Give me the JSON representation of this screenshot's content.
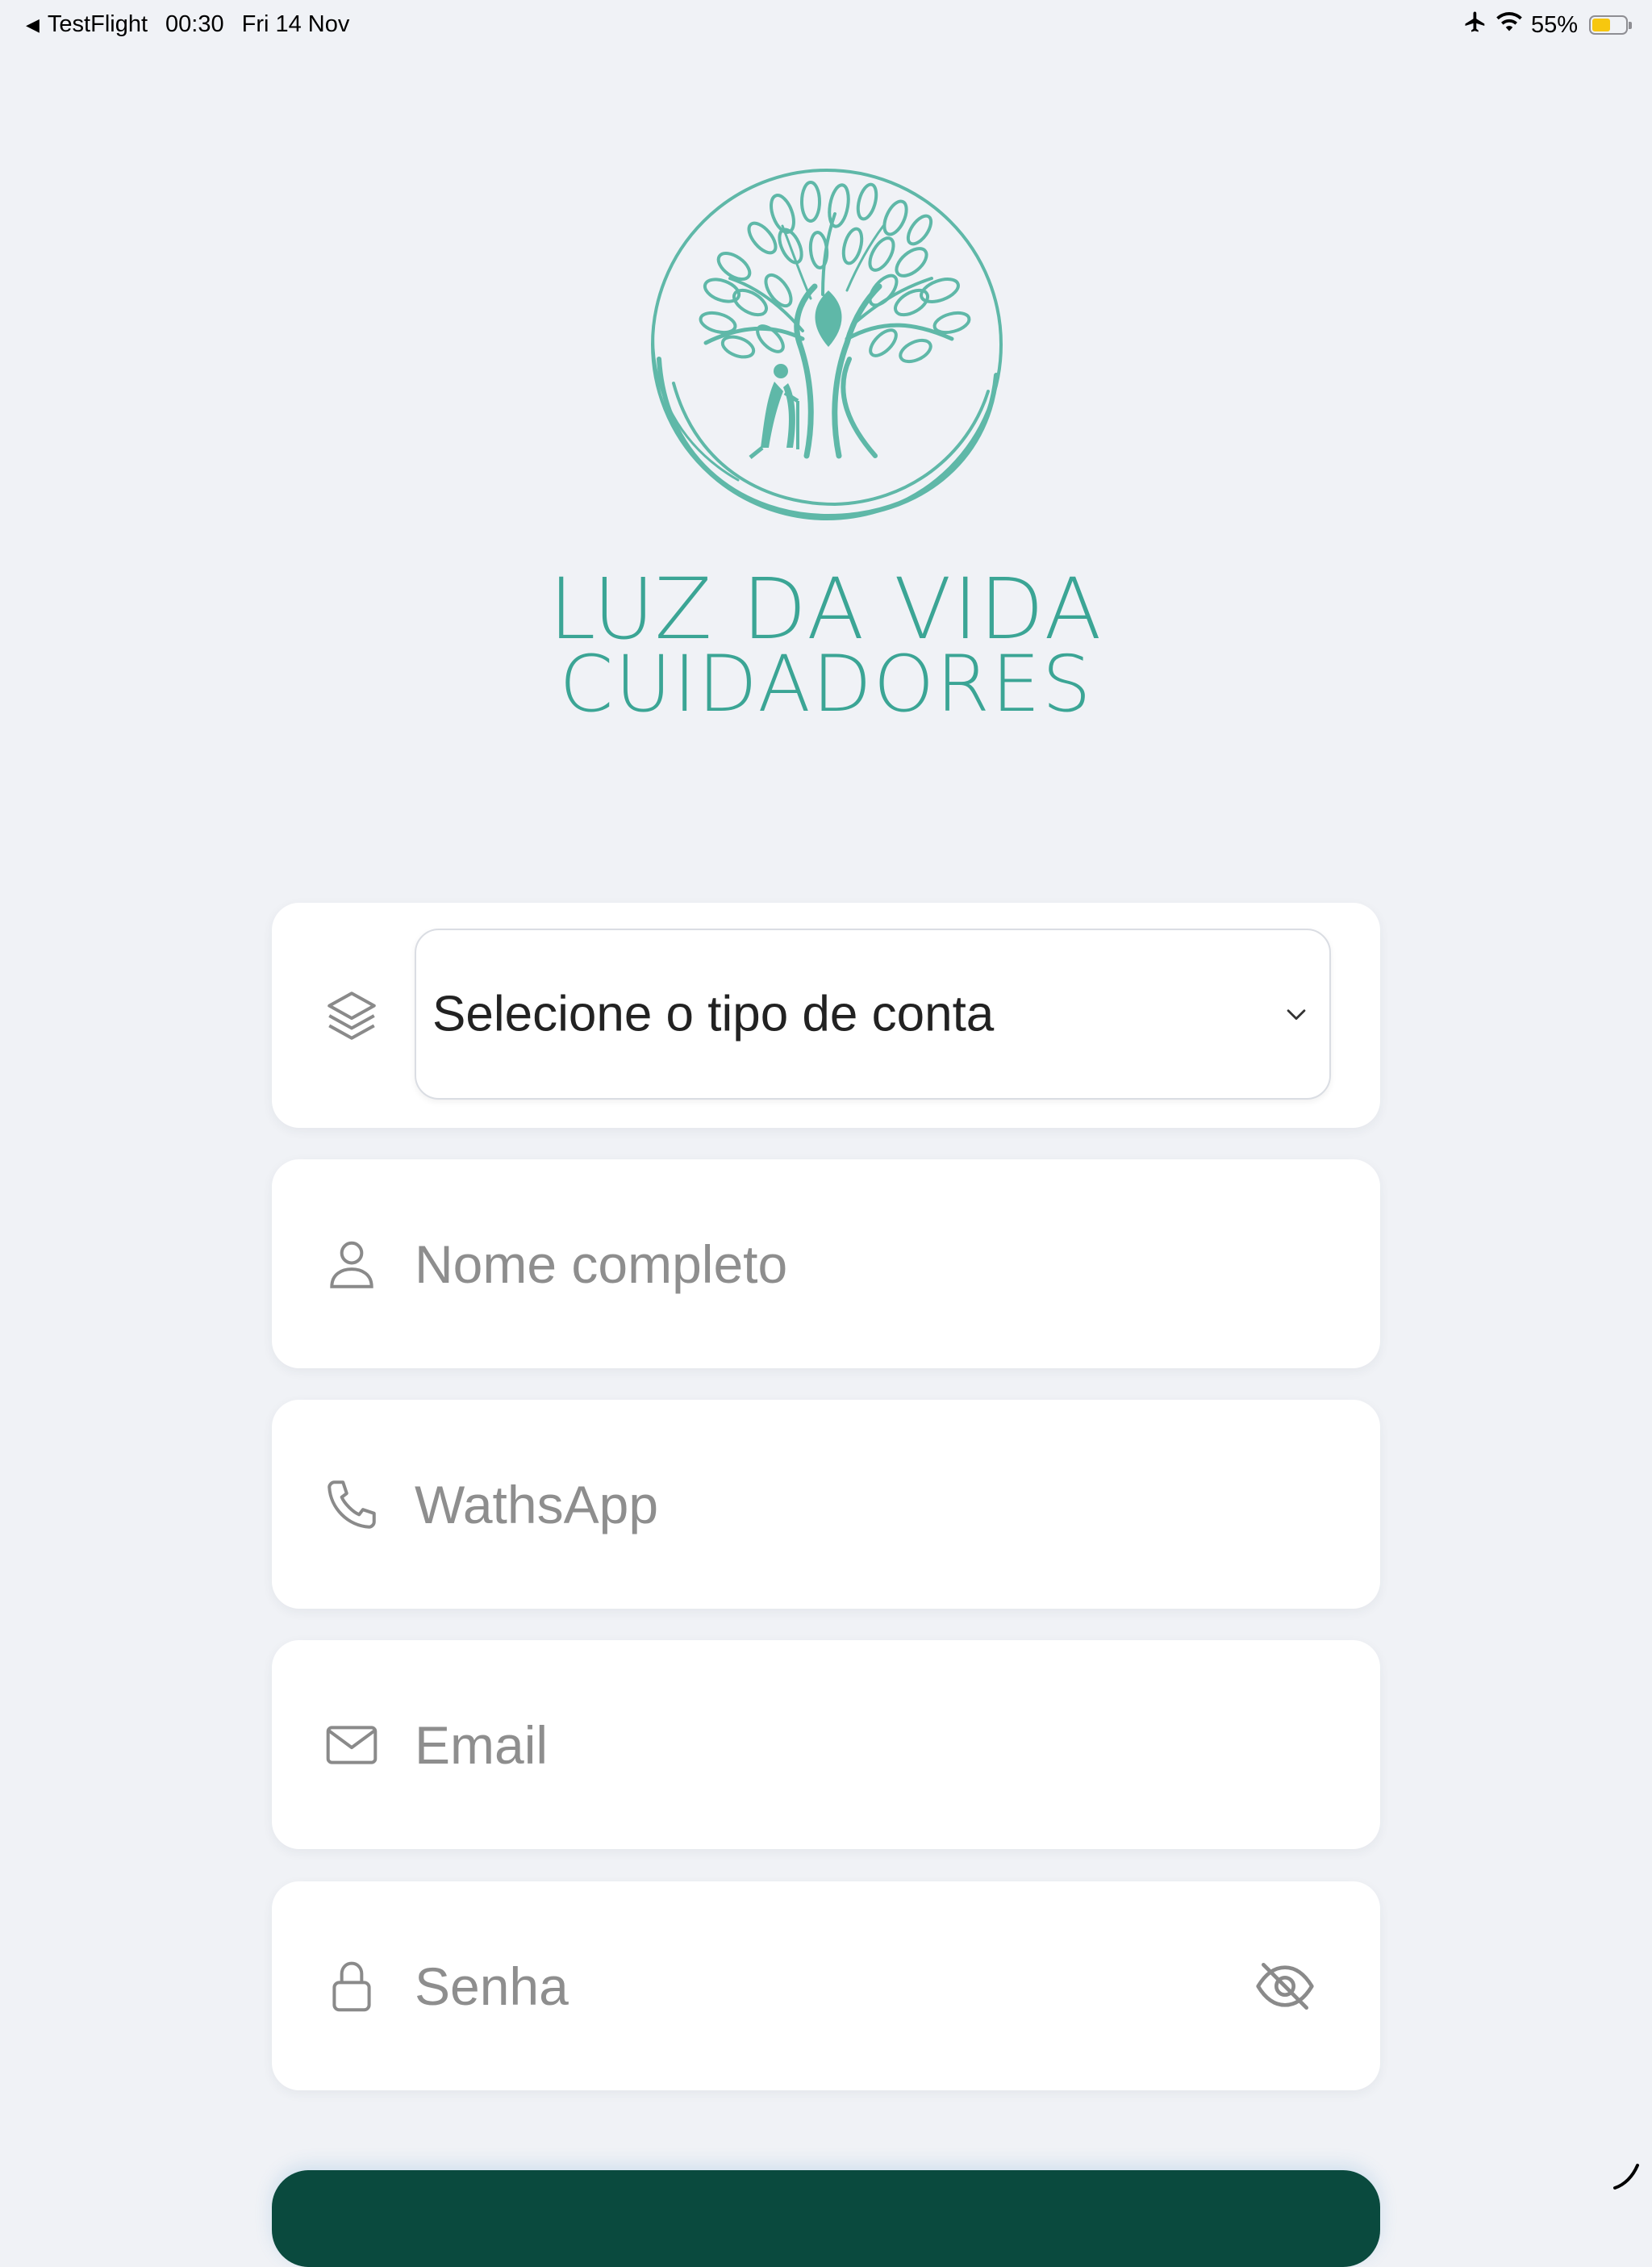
{
  "status_bar": {
    "back_app": "TestFlight",
    "time": "00:30",
    "date": "Fri 14 Nov",
    "battery_percent": "55%",
    "battery_level": 0.55,
    "icons": [
      "airplane-icon",
      "wifi-icon",
      "battery-icon"
    ]
  },
  "brand": {
    "line1": "LUZ DA VIDA",
    "line2": "CUIDADORES",
    "color": "#3ba595"
  },
  "form": {
    "account_type": {
      "label": "Selecione o tipo de conta",
      "icon": "layers-icon"
    },
    "name": {
      "placeholder": "Nome completo",
      "value": "",
      "icon": "user-icon"
    },
    "phone": {
      "placeholder": "WathsApp",
      "value": "",
      "icon": "phone-icon"
    },
    "email": {
      "placeholder": "Email",
      "value": "",
      "icon": "mail-icon"
    },
    "password": {
      "placeholder": "Senha",
      "value": "",
      "icon": "lock-icon",
      "toggle_icon": "eye-off-icon"
    }
  },
  "colors": {
    "background": "#f0f2f6",
    "primary_button": "#0a4a3e",
    "placeholder": "#8e8e8e",
    "icon": "#8a8a8a"
  }
}
